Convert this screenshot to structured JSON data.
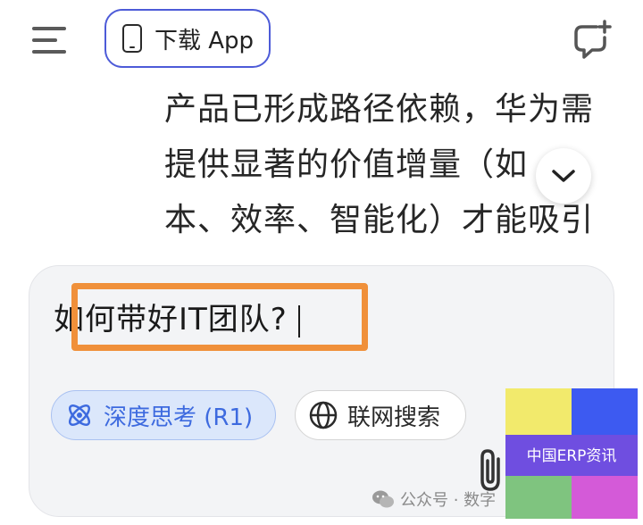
{
  "header": {
    "download_label": "下载 App",
    "icons": [
      "menu-icon",
      "phone-icon",
      "new-chat-icon"
    ]
  },
  "chat": {
    "lines": [
      "产品已形成路径依赖，华为需",
      "提供显著的价值增量（如",
      "本、效率、智能化）才能吸引"
    ]
  },
  "input": {
    "value": "如何带好IT团队?"
  },
  "chips": {
    "deep_think": "深度思考 (R1)",
    "web_search": "联网搜索"
  },
  "watermark": {
    "text": "公众号 · 数字"
  },
  "logo": {
    "text": "中国ERP资讯",
    "colors": [
      "#f2ea6c",
      "#3d5af1",
      "#6f4ee0",
      "#7fc47f",
      "#d45ad8"
    ]
  },
  "colors": {
    "accent": "#4d5bd8",
    "highlight": "#f0903a",
    "chip_blue": "#3d6adf"
  }
}
